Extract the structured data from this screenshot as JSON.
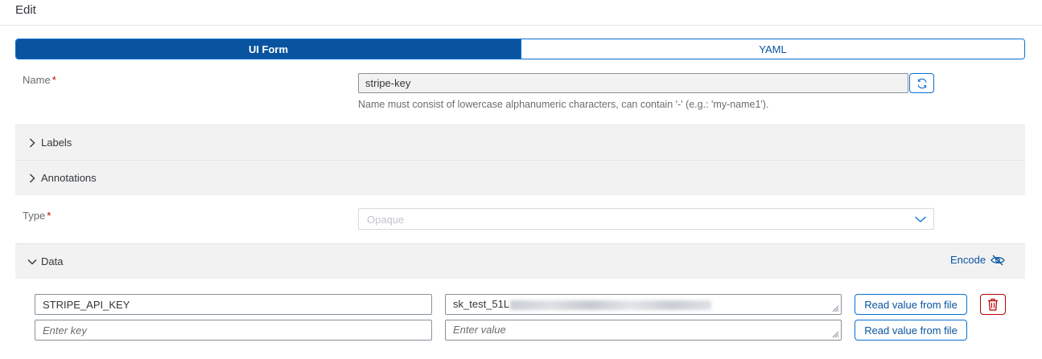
{
  "header": {
    "title": "Edit"
  },
  "tabs": [
    {
      "label": "UI Form",
      "active": true
    },
    {
      "label": "YAML",
      "active": false
    }
  ],
  "name_field": {
    "label": "Name",
    "required_mark": "*",
    "value": "stripe-key",
    "hint": "Name must consist of lowercase alphanumeric characters, can contain '-' (e.g.: 'my-name1')."
  },
  "labels_panel": {
    "title": "Labels",
    "expanded": false
  },
  "annotations_panel": {
    "title": "Annotations",
    "expanded": false
  },
  "type_field": {
    "label": "Type",
    "required_mark": "*",
    "placeholder": "Opaque"
  },
  "data_panel": {
    "title": "Data",
    "expanded": true,
    "encode_label": "Encode",
    "rows": [
      {
        "key": "STRIPE_API_KEY",
        "value_visible": "sk_test_51L",
        "value_obscured": true,
        "file_button": "Read value from file",
        "deletable": true
      },
      {
        "key_placeholder": "Enter key",
        "value_placeholder": "Enter value",
        "file_button": "Read value from file",
        "deletable": false
      }
    ]
  },
  "colors": {
    "accent": "#0854a0",
    "border_accent": "#0a6ed1",
    "required": "#bb0000",
    "panel_bg": "#f2f2f2"
  }
}
